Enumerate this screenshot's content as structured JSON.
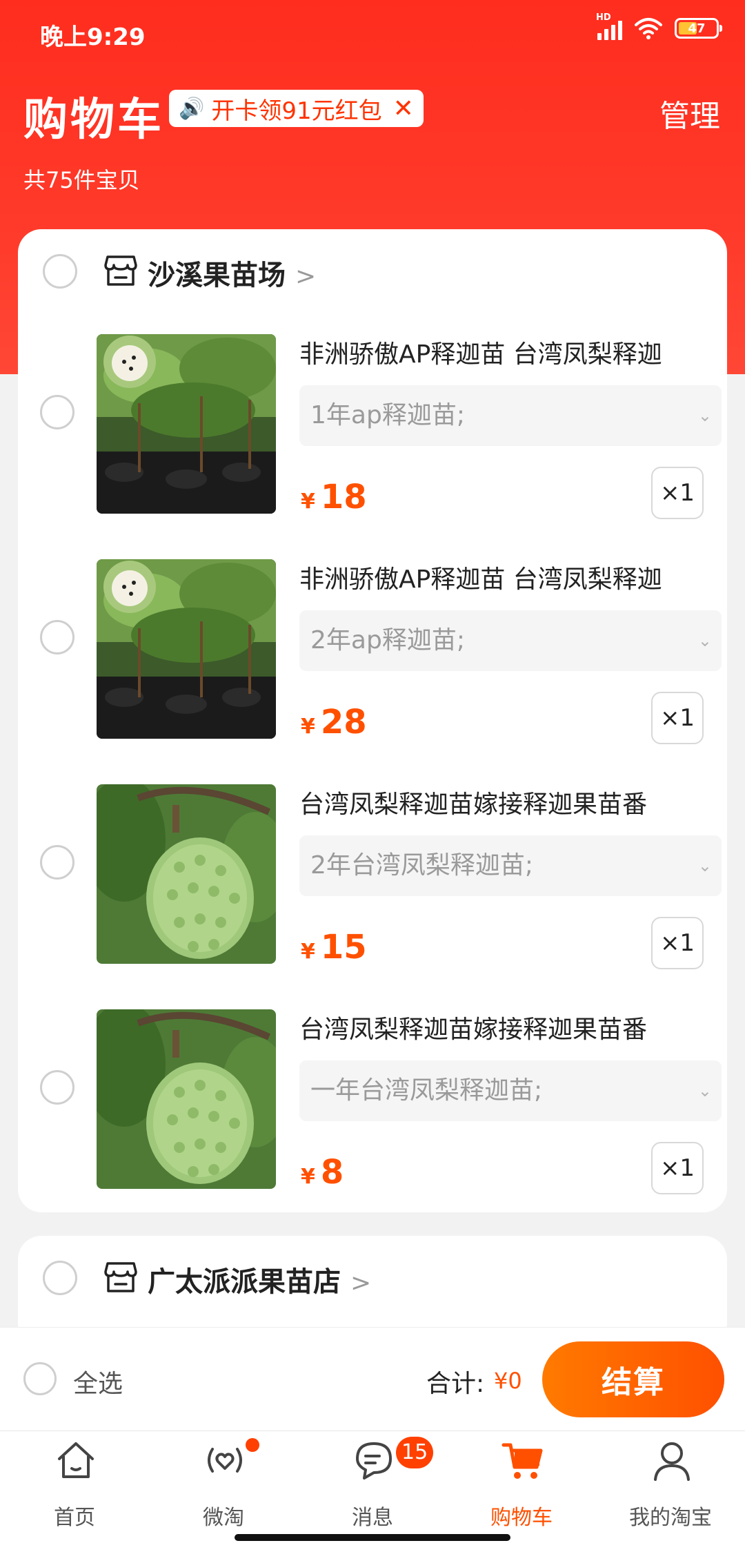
{
  "status": {
    "time": "晚上9:29",
    "battery": "47"
  },
  "header": {
    "title": "购物车",
    "promo": "开卡领91元红包",
    "manage": "管理",
    "count": "共75件宝贝"
  },
  "shops": [
    {
      "name": "沙溪果苗场",
      "items": [
        {
          "title": "非洲骄傲AP释迦苗 台湾凤梨释迦",
          "variant": "1年ap释迦苗;",
          "currency": "¥",
          "price": "18",
          "qty": "×1",
          "image": "annona-seedlings-photo"
        },
        {
          "title": "非洲骄傲AP释迦苗 台湾凤梨释迦",
          "variant": "2年ap释迦苗;",
          "currency": "¥",
          "price": "28",
          "qty": "×1",
          "image": "annona-seedlings-photo"
        },
        {
          "title": "台湾凤梨释迦苗嫁接释迦果苗番",
          "variant": "2年台湾凤梨释迦苗;",
          "currency": "¥",
          "price": "15",
          "qty": "×1",
          "image": "sugar-apple-fruit-photo"
        },
        {
          "title": "台湾凤梨释迦苗嫁接释迦果苗番",
          "variant": "一年台湾凤梨释迦苗;",
          "currency": "¥",
          "price": "8",
          "qty": "×1",
          "image": "sugar-apple-fruit-photo"
        }
      ]
    },
    {
      "name": "广太派派果苗店"
    }
  ],
  "checkout": {
    "select_all": "全选",
    "total_label": "合计:",
    "total_value": "¥0",
    "pay": "结算"
  },
  "tabs": [
    {
      "label": "首页",
      "icon": "home-icon"
    },
    {
      "label": "微淘",
      "icon": "weitao-icon"
    },
    {
      "label": "消息",
      "icon": "message-icon",
      "badge": "15"
    },
    {
      "label": "购物车",
      "icon": "cart-icon"
    },
    {
      "label": "我的淘宝",
      "icon": "profile-icon"
    }
  ],
  "colors": {
    "accent": "#ff5000",
    "header_red": "#ff2d1e"
  }
}
